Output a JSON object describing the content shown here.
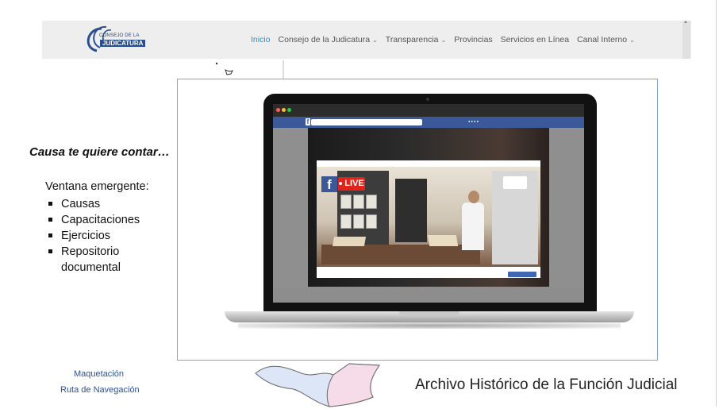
{
  "header": {
    "logo_line1": "CONSEJO DE LA",
    "logo_line2": "JUDICATURA",
    "nav": [
      {
        "label": "Inicio",
        "active": true,
        "dropdown": false
      },
      {
        "label": "Consejo de la Judicatura",
        "active": false,
        "dropdown": true
      },
      {
        "label": "Transparencia",
        "active": false,
        "dropdown": true
      },
      {
        "label": "Provincias",
        "active": false,
        "dropdown": false
      },
      {
        "label": "Servicios en Línea",
        "active": false,
        "dropdown": false
      },
      {
        "label": "Canal Interno",
        "active": false,
        "dropdown": true
      }
    ]
  },
  "left_panel": {
    "title": "Causa te quiere contar…",
    "subtitle": "Ventana emergente:",
    "items": [
      "Causas",
      "Capacitaciones",
      "Ejercicios",
      "Repositorio documental"
    ]
  },
  "links": {
    "maquetacion": "Maquetación",
    "ruta": "Ruta de Navegación"
  },
  "footer_title": "Archivo Histórico de la Función Judicial",
  "popup": {
    "live_badge": "LIVE",
    "facebook_letter": "f"
  },
  "colors": {
    "nav_active": "#2a8fd6",
    "nav_bg": "#eeeeee",
    "popup_border": "#8aa4c8",
    "facebook_blue": "#3b5998",
    "live_red": "#e2231a",
    "link_color": "#2f4f8f"
  }
}
